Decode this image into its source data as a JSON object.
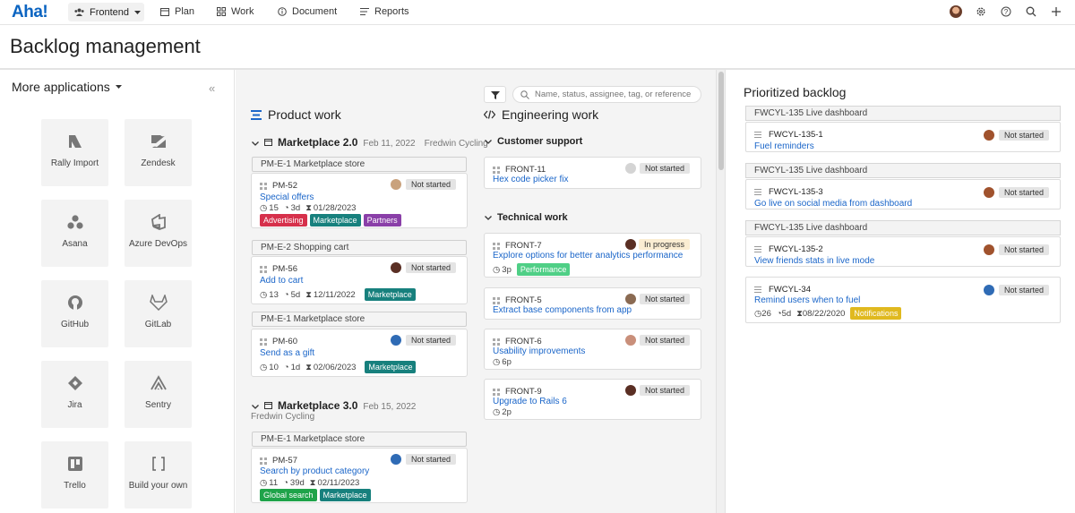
{
  "nav": {
    "logo": "Aha!",
    "workspace": "Frontend",
    "items": [
      "Plan",
      "Work",
      "Document",
      "Reports"
    ]
  },
  "page_title": "Backlog management",
  "left": {
    "more_apps": "More applications",
    "apps": [
      "Rally Import",
      "Zendesk",
      "Asana",
      "Azure DevOps",
      "GitHub",
      "GitLab",
      "Jira",
      "Sentry",
      "Trello",
      "Build your own"
    ]
  },
  "toolbar": {
    "search_placeholder": "Name, status, assignee, tag, or reference"
  },
  "product": {
    "title": "Product work",
    "release1": {
      "name": "Marketplace 2.0",
      "date": "Feb 11, 2022",
      "owner": "Fredwin Cycling"
    },
    "release2": {
      "name": "Marketplace 3.0",
      "date": "Feb 15, 2022",
      "owner": "Fredwin Cycling"
    },
    "groups": [
      {
        "label": "PM-E-1 Marketplace store",
        "card": {
          "ref": "PM-52",
          "title": "Special offers",
          "score": "15",
          "est": "3d",
          "due": "01/28/2023",
          "status": "Not started",
          "tags": [
            {
              "text": "Advertising",
              "color": "#d6304b"
            },
            {
              "text": "Marketplace",
              "color": "#17807d"
            },
            {
              "text": "Partners",
              "color": "#8a3fa8"
            }
          ]
        }
      },
      {
        "label": "PM-E-2 Shopping cart",
        "card": {
          "ref": "PM-56",
          "title": "Add to cart",
          "score": "13",
          "est": "5d",
          "due": "12/11/2022",
          "status": "Not started",
          "tags": [
            {
              "text": "Marketplace",
              "color": "#17807d"
            }
          ]
        }
      },
      {
        "label": "PM-E-1 Marketplace store",
        "card": {
          "ref": "PM-60",
          "title": "Send as a gift",
          "score": "10",
          "est": "1d",
          "due": "02/06/2023",
          "status": "Not started",
          "tags": [
            {
              "text": "Marketplace",
              "color": "#17807d"
            }
          ]
        }
      },
      {
        "label": "PM-E-1 Marketplace store",
        "card": {
          "ref": "PM-57",
          "title": "Search by product category",
          "score": "11",
          "est": "39d",
          "due": "02/11/2023",
          "status": "Not started",
          "tags": [
            {
              "text": "Global search",
              "color": "#1fa34a"
            },
            {
              "text": "Marketplace",
              "color": "#17807d"
            }
          ]
        }
      }
    ]
  },
  "engineering": {
    "title": "Engineering work",
    "customer_support": {
      "heading": "Customer support",
      "cards": [
        {
          "ref": "FRONT-11",
          "title": "Hex code picker fix",
          "status": "Not started"
        }
      ]
    },
    "technical": {
      "heading": "Technical work",
      "cards": [
        {
          "ref": "FRONT-7",
          "title": "Explore options for better analytics performance",
          "status": "In progress",
          "points": "3p",
          "tag": "Performance",
          "tag_color": "#4fcf86"
        },
        {
          "ref": "FRONT-5",
          "title": "Extract base components from app",
          "status": "Not started"
        },
        {
          "ref": "FRONT-6",
          "title": "Usability improvements",
          "status": "Not started",
          "points": "6p"
        },
        {
          "ref": "FRONT-9",
          "title": "Upgrade to Rails 6",
          "status": "Not started",
          "points": "2p"
        }
      ]
    }
  },
  "prioritized": {
    "title": "Prioritized backlog",
    "groups": [
      {
        "label": "FWCYL-135 Live dashboard",
        "card": {
          "ref": "FWCYL-135-1",
          "title": "Fuel reminders",
          "status": "Not started"
        }
      },
      {
        "label": "FWCYL-135 Live dashboard",
        "card": {
          "ref": "FWCYL-135-3",
          "title": "Go live on social media from dashboard",
          "status": "Not started"
        }
      },
      {
        "label": "FWCYL-135 Live dashboard",
        "card": {
          "ref": "FWCYL-135-2",
          "title": "View friends stats in live mode",
          "status": "Not started"
        }
      }
    ],
    "extra": {
      "ref": "FWCYL-34",
      "title": "Remind users when to fuel",
      "status": "Not started",
      "score": "26",
      "est": "5d",
      "due": "08/22/2020",
      "tag": "Notifications",
      "tag_color": "#e0b91f"
    }
  }
}
